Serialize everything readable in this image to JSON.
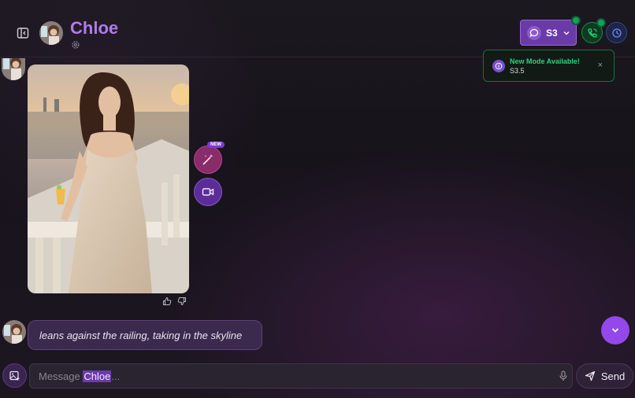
{
  "header": {
    "character_name": "Chloe",
    "mode_label": "S3"
  },
  "toast": {
    "title": "New Mode Available!",
    "subtitle": "S3.5",
    "close_glyph": "×"
  },
  "messages": {
    "badge_new": "NEW",
    "action_text": "leans against the railing, taking in the skyline"
  },
  "composer": {
    "placeholder_prefix": "Message ",
    "placeholder_name": "Chloe",
    "placeholder_suffix": "...",
    "send_label": "Send"
  },
  "colors": {
    "accent": "#9248ea",
    "name": "#b07be8",
    "toast_green": "#2bd57a"
  },
  "icons": [
    "sidebar-toggle-icon",
    "settings-icon",
    "chat-bubble-icon",
    "chevron-down-icon",
    "phone-call-icon",
    "history-icon",
    "info-icon",
    "close-icon",
    "thumbs-up-icon",
    "thumbs-down-icon",
    "magic-wand-icon",
    "video-icon",
    "image-upload-icon",
    "mic-icon",
    "send-icon"
  ]
}
